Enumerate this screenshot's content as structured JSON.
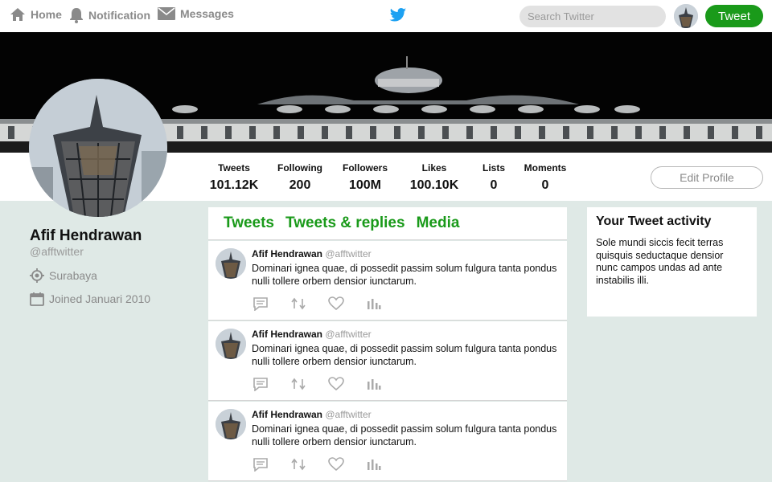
{
  "nav": {
    "home": "Home",
    "notification": "Notification",
    "messages": "Messages",
    "search_placeholder": "Search Twitter",
    "tweet_button": "Tweet"
  },
  "profile": {
    "name": "Afif Hendrawan",
    "handle": "@afftwitter",
    "location": "Surabaya",
    "joined": "Joined Januari 2010",
    "edit_button": "Edit Profile"
  },
  "stats": [
    {
      "label": "Tweets",
      "value": "101.12K"
    },
    {
      "label": "Following",
      "value": "200"
    },
    {
      "label": "Followers",
      "value": "100M"
    },
    {
      "label": "Likes",
      "value": "100.10K"
    },
    {
      "label": "Lists",
      "value": "0"
    },
    {
      "label": "Moments",
      "value": "0"
    }
  ],
  "tabs": [
    "Tweets",
    "Tweets & replies",
    "Media"
  ],
  "tweets": [
    {
      "name": "Afif Hendrawan",
      "handle": "@afftwitter",
      "text": "Dominari ignea quae, di possedit passim solum fulgura tanta pondus nulli tollere orbem densior iunctarum."
    },
    {
      "name": "Afif Hendrawan",
      "handle": "@afftwitter",
      "text": "Dominari ignea quae, di possedit passim solum fulgura tanta pondus nulli tollere orbem densior iunctarum."
    },
    {
      "name": "Afif Hendrawan",
      "handle": "@afftwitter",
      "text": "Dominari ignea quae, di possedit passim solum fulgura tanta pondus nulli tollere orbem densior iunctarum."
    }
  ],
  "activity": {
    "title": "Your Tweet activity",
    "text": "Sole  mundi siccis fecit terras quisquis seductaque densior nunc campos undas ad ante instabilis illi."
  },
  "colors": {
    "accent": "#1a9a1a",
    "twitter_blue": "#1da1f2",
    "page_bg": "#dfe9e6",
    "muted": "#8a8a8a"
  },
  "icons": {
    "home": "home-icon",
    "notification": "bell-icon",
    "messages": "envelope-icon",
    "logo": "twitter-bird-icon",
    "location": "location-target-icon",
    "joined": "calendar-icon",
    "reply": "reply-icon",
    "retweet": "retweet-icon",
    "like": "heart-icon",
    "analytics": "analytics-icon"
  }
}
